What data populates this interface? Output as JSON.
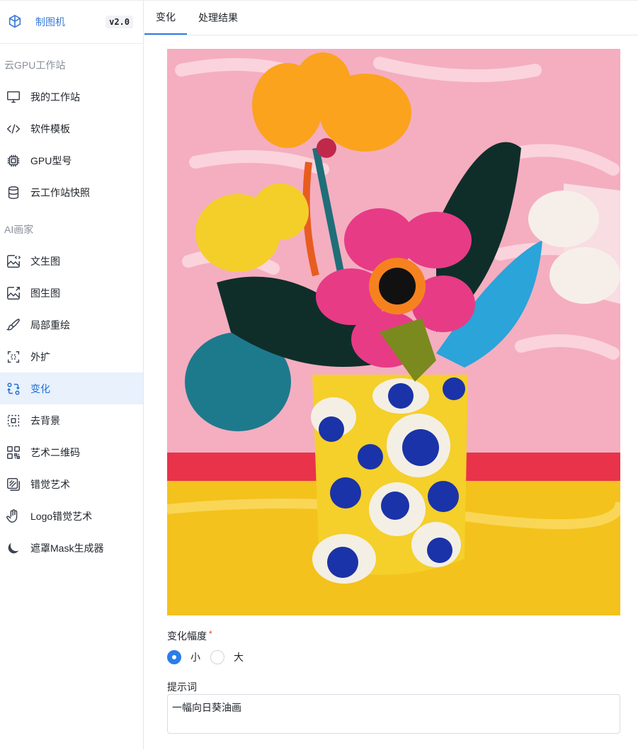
{
  "brand": {
    "name": "制图机",
    "version": "v2.0"
  },
  "sidebar": {
    "groups": [
      {
        "title": "云GPU工作站",
        "items": [
          {
            "label": "我的工作站",
            "icon": "monitor-icon"
          },
          {
            "label": "软件模板",
            "icon": "code-icon"
          },
          {
            "label": "GPU型号",
            "icon": "chip-icon"
          },
          {
            "label": "云工作站快照",
            "icon": "database-icon"
          }
        ]
      },
      {
        "title": "AI画家",
        "items": [
          {
            "label": "文生图",
            "icon": "image-code-icon"
          },
          {
            "label": "图生图",
            "icon": "image-arrow-icon"
          },
          {
            "label": "局部重绘",
            "icon": "brush-icon"
          },
          {
            "label": "外扩",
            "icon": "expand-icon"
          },
          {
            "label": "变化",
            "icon": "swap-icon",
            "active": true
          },
          {
            "label": "去背景",
            "icon": "remove-bg-icon"
          },
          {
            "label": "艺术二维码",
            "icon": "qrcode-icon"
          },
          {
            "label": "错觉艺术",
            "icon": "illusion-icon"
          },
          {
            "label": "Logo错觉艺术",
            "icon": "hand-icon"
          },
          {
            "label": "遮罩Mask生成器",
            "icon": "moon-icon"
          }
        ]
      }
    ]
  },
  "tabs": [
    {
      "label": "变化",
      "active": true
    },
    {
      "label": "处理结果",
      "active": false
    }
  ],
  "form": {
    "variation_label": "变化幅度",
    "required_mark": "*",
    "options": [
      {
        "label": "小",
        "checked": true
      },
      {
        "label": "大",
        "checked": false
      }
    ],
    "prompt_label": "提示词",
    "prompt_value": "一幅向日葵油画"
  },
  "colors": {
    "accent": "#2b7de9",
    "active_bg": "#e8f1fc"
  }
}
